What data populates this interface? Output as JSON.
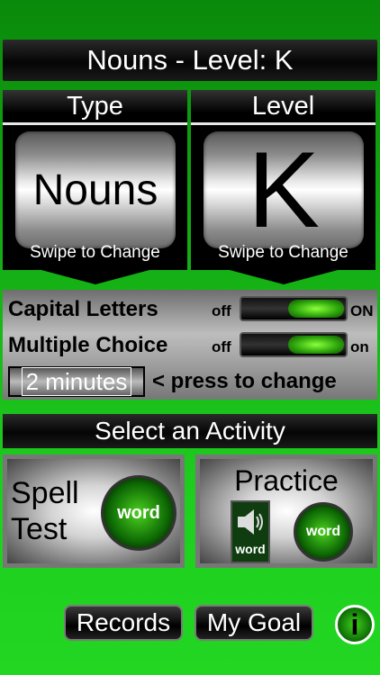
{
  "header": {
    "title": "Nouns - Level:  K"
  },
  "type_panel": {
    "header": "Type",
    "value": "Nouns",
    "swipe_hint": "Swipe to Change"
  },
  "level_panel": {
    "header": "Level",
    "value": "K",
    "swipe_hint": "Swipe to Change"
  },
  "settings": {
    "capital_letters": {
      "label": "Capital Letters",
      "off_label": "off",
      "on_label": "ON"
    },
    "multiple_choice": {
      "label": "Multiple Choice",
      "off_label": "off",
      "on_label": "on"
    },
    "time": {
      "value": "2 minutes",
      "hint": "< press to change"
    }
  },
  "activity": {
    "header": "Select an Activity",
    "spell_test": {
      "line1": "Spell",
      "line2": "Test",
      "icon_label": "word"
    },
    "practice": {
      "title": "Practice",
      "speaker_label": "word",
      "icon_label": "word"
    }
  },
  "footer": {
    "records": "Records",
    "my_goal": "My Goal",
    "info": "i"
  },
  "colors": {
    "background": "#16b416",
    "accent_green": "#2fa80c"
  }
}
